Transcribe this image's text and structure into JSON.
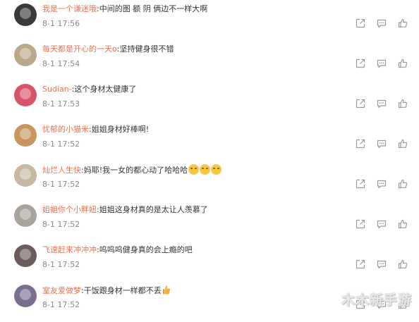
{
  "comments": [
    {
      "username": "我是一个谦迷哦",
      "text": "中间的图 额 阴 俩边不一样大啊",
      "time": "8-1 17:56",
      "avatar_color": "#3a3a3a",
      "emoji_count": 0,
      "thumb": false
    },
    {
      "username": "每天都是开心的一天o",
      "text": "坚持健身很不错",
      "time": "8-1 17:54",
      "avatar_color": "#b9a88a",
      "emoji_count": 0,
      "thumb": false
    },
    {
      "username": "Sudian-",
      "text": "这个身材太健康了",
      "time": "8-1 17:53",
      "avatar_color": "#d9546a",
      "emoji_count": 0,
      "thumb": false
    },
    {
      "username": "忧郁的小猫米",
      "text": "姐姐身材好棒啊!",
      "time": "8-1 17:52",
      "avatar_color": "#c79660",
      "emoji_count": 0,
      "thumb": false
    },
    {
      "username": "灿烂人生快",
      "text": "妈耶!我一女的都心动了哈哈哈",
      "time": "8-1 17:52",
      "avatar_color": "#c7b8a2",
      "emoji_count": 3,
      "thumb": false
    },
    {
      "username": "姐姐你个小胖妞",
      "text": "姐姐这身材真的是太让人羡慕了",
      "time": "8-1 17:52",
      "avatar_color": "#a8a39c",
      "emoji_count": 0,
      "thumb": false
    },
    {
      "username": "飞速赶来冲冲冲",
      "text": "呜呜呜健身真的会上瘾的吧",
      "time": "8-1 17:52",
      "avatar_color": "#6b5b5b",
      "emoji_count": 0,
      "thumb": false
    },
    {
      "username": "室友爱做梦",
      "text": "干饭跟身材一样都不丢",
      "time": "8-1 17:52",
      "avatar_color": "#7a6f8f",
      "emoji_count": 0,
      "thumb": true
    }
  ],
  "separator": ":",
  "icons": {
    "share": "share-icon",
    "comment": "comment-icon",
    "like": "thumbs-up-icon"
  },
  "colors": {
    "username": "#eb7350",
    "text": "#333333",
    "time": "#888888",
    "icon": "#9a9a9a"
  },
  "watermark": "木木新手游"
}
